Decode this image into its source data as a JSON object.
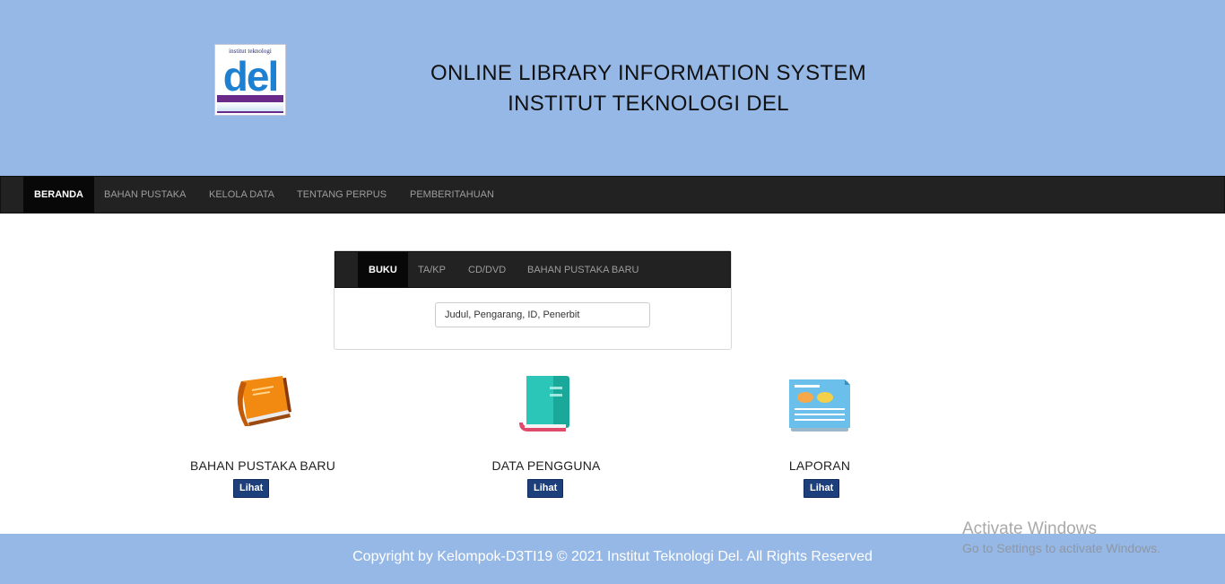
{
  "header": {
    "logo_top_text": "institut teknologi",
    "logo_text": "del",
    "title_line1": "ONLINE LIBRARY INFORMATION SYSTEM",
    "title_line2": "INSTITUT TEKNOLOGI DEL",
    "background_color": "#96b8e6"
  },
  "nav": {
    "items": [
      {
        "label": "BERANDA",
        "active": true
      },
      {
        "label": "BAHAN PUSTAKA",
        "active": false
      },
      {
        "label": "KELOLA DATA",
        "active": false
      },
      {
        "label": "TENTANG PERPUS",
        "active": false
      },
      {
        "label": "PEMBERITAHUAN",
        "active": false
      }
    ]
  },
  "search": {
    "tabs": [
      {
        "label": "BUKU",
        "active": true
      },
      {
        "label": "TA/KP",
        "active": false
      },
      {
        "label": "CD/DVD",
        "active": false
      },
      {
        "label": "BAHAN PUSTAKA BARU",
        "active": false
      }
    ],
    "placeholder": "Judul, Pengarang, ID, Penerbit"
  },
  "features": [
    {
      "label": "BAHAN PUSTAKA BARU",
      "button": "Lihat",
      "icon": "orange-book-icon"
    },
    {
      "label": "DATA PENGGUNA",
      "button": "Lihat",
      "icon": "teal-book-icon"
    },
    {
      "label": "LAPORAN",
      "button": "Lihat",
      "icon": "report-document-icon"
    }
  ],
  "footer": {
    "text": "Copyright by Kelompok-D3TI19 © 2021 Institut Teknologi Del. All Rights Reserved"
  },
  "watermark": {
    "title": "Activate Windows",
    "subtitle": "Go to Settings to activate Windows."
  },
  "colors": {
    "navbar": "#222222",
    "nav_active": "#080808",
    "button": "#1d3f7c"
  }
}
